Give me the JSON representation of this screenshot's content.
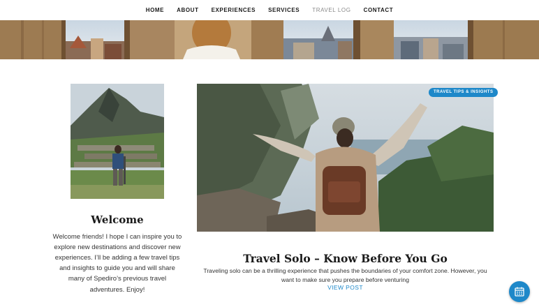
{
  "nav": {
    "items": [
      {
        "label": "HOME",
        "active": false
      },
      {
        "label": "ABOUT",
        "active": false
      },
      {
        "label": "EXPERIENCES",
        "active": false
      },
      {
        "label": "SERVICES",
        "active": false
      },
      {
        "label": "TRAVEL LOG",
        "active": true
      },
      {
        "label": "CONTACT",
        "active": false
      }
    ]
  },
  "sidebar": {
    "title": "Welcome",
    "text": "Welcome friends! I hope I can inspire you to explore new destinations and discover new experiences. I’ll be adding a few travel tips and insights to guide you and will share many of Spediro’s previous travel adventures. Enjoy!"
  },
  "post": {
    "category": "TRAVEL TIPS & INSIGHTS",
    "title": "Travel Solo – Know Before You Go",
    "excerpt": "Traveling solo can be a thrilling experience that pushes the boundaries of your comfort zone. However, you want to make sure you prepare before venturing",
    "cta": "VIEW POST"
  },
  "floating_button": {
    "icon": "calendar-icon"
  },
  "colors": {
    "accent": "#1e88c9",
    "nav_active": "#8a8a8a",
    "text": "#1a1a1a"
  }
}
